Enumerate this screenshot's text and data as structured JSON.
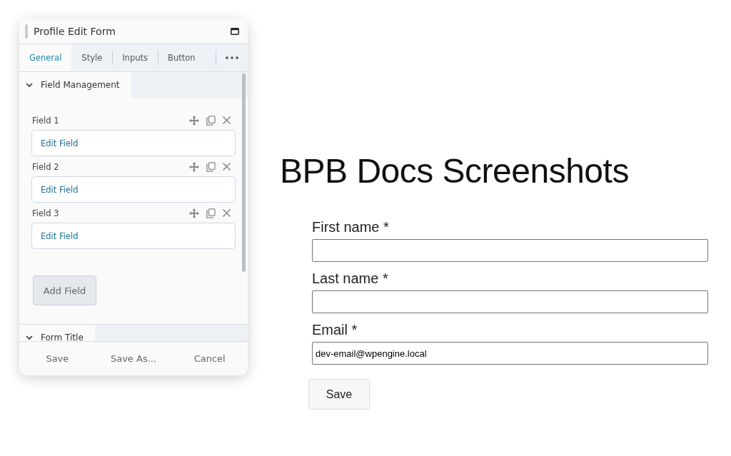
{
  "panel": {
    "title": "Profile Edit Form",
    "tabs": [
      {
        "label": "General",
        "selected": true
      },
      {
        "label": "Style",
        "selected": false
      },
      {
        "label": "Inputs",
        "selected": false
      },
      {
        "label": "Button",
        "selected": false
      }
    ],
    "sections": [
      {
        "title": "Field Management",
        "expanded": true,
        "fields": [
          {
            "label": "Field 1",
            "link": "Edit Field"
          },
          {
            "label": "Field 2",
            "link": "Edit Field"
          },
          {
            "label": "Field 3",
            "link": "Edit Field"
          }
        ],
        "add_button": "Add Field"
      },
      {
        "title": "Form Title",
        "expanded": false
      }
    ],
    "footer_buttons": [
      "Save",
      "Save As...",
      "Cancel"
    ]
  },
  "page": {
    "heading": "BPB Docs Screenshots",
    "form_fields": [
      {
        "label": "First name *"
      },
      {
        "label": "Last name *"
      },
      {
        "label": "Email *",
        "value": "dev-email@wpengine.local"
      }
    ],
    "submit": "Save"
  }
}
